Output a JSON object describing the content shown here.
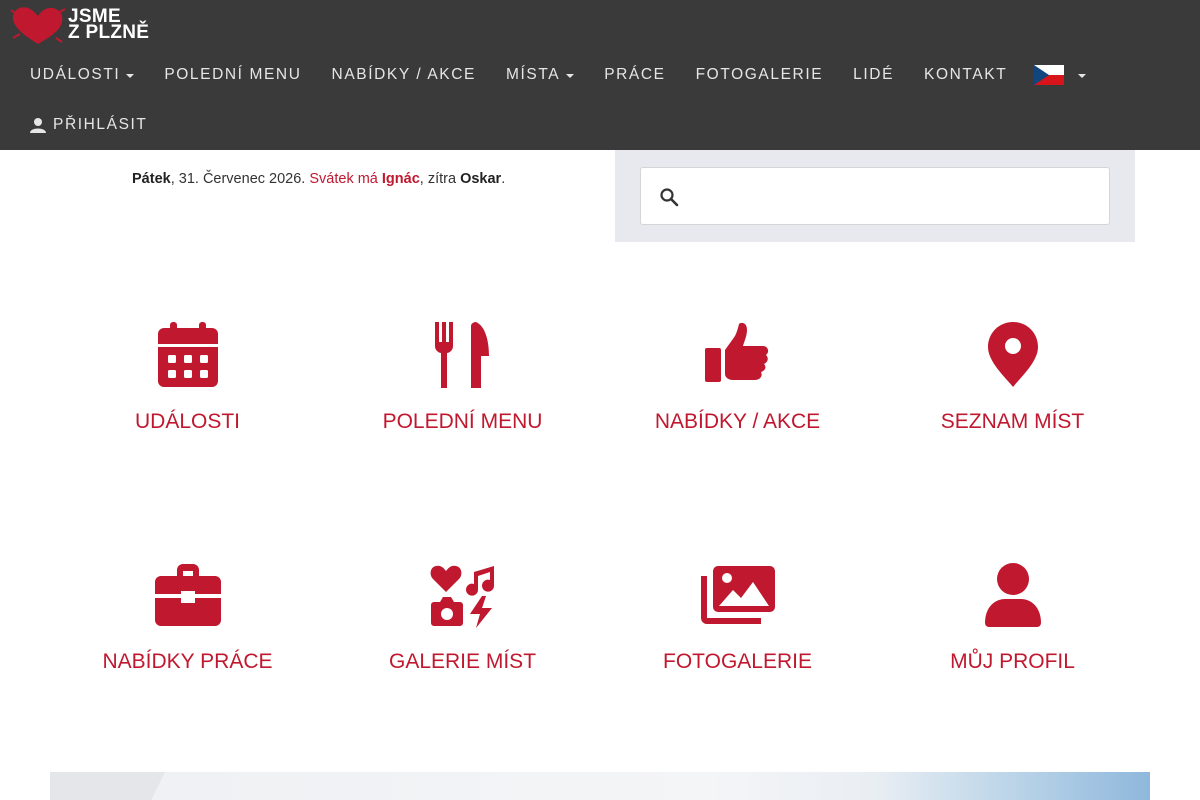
{
  "logo": {
    "line1": "JSME",
    "line2": "Z PLZNĚ"
  },
  "nav": {
    "items": [
      {
        "label": "UDÁLOSTI",
        "dropdown": true
      },
      {
        "label": "POLEDNÍ MENU",
        "dropdown": false
      },
      {
        "label": "NABÍDKY / AKCE",
        "dropdown": false
      },
      {
        "label": "MÍSTA",
        "dropdown": true
      },
      {
        "label": "PRÁCE",
        "dropdown": false
      },
      {
        "label": "FOTOGALERIE",
        "dropdown": false
      },
      {
        "label": "LIDÉ",
        "dropdown": false
      },
      {
        "label": "KONTAKT",
        "dropdown": false
      }
    ],
    "language_icon": "czech-flag-icon",
    "login_label": "PŘIHLÁSIT"
  },
  "dateline": {
    "day": "Pátek",
    "date": ", 31. Červenec 2026. ",
    "nameday_prefix": "Svátek má ",
    "nameday_name": "Ignác",
    "tomorrow_prefix": ", zítra ",
    "tomorrow_name": "Oskar",
    "end": "."
  },
  "search": {
    "placeholder": "",
    "value": ""
  },
  "tiles": [
    {
      "label": "UDÁLOSTI",
      "icon": "calendar-icon"
    },
    {
      "label": "POLEDNÍ MENU",
      "icon": "fork-knife-icon"
    },
    {
      "label": "NABÍDKY / AKCE",
      "icon": "thumbs-up-icon"
    },
    {
      "label": "SEZNAM MÍST",
      "icon": "map-pin-icon"
    },
    {
      "label": "NABÍDKY PRÁCE",
      "icon": "briefcase-icon"
    },
    {
      "label": "GALERIE MÍST",
      "icon": "icons-collage-icon"
    },
    {
      "label": "FOTOGALERIE",
      "icon": "photos-icon"
    },
    {
      "label": "MŮJ PROFIL",
      "icon": "user-icon"
    }
  ],
  "colors": {
    "navbar": "#3a3a3a",
    "accent": "#c0182f",
    "search_panel": "#e8e9ee"
  }
}
